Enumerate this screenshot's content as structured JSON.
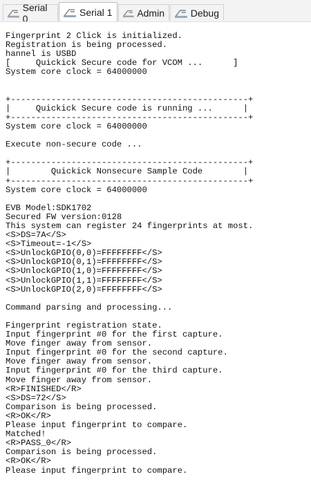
{
  "tabs": [
    {
      "label": "Serial 0",
      "icon": "serial-port-icon",
      "active": false
    },
    {
      "label": "Serial 1",
      "icon": "serial-port-icon",
      "active": true
    },
    {
      "label": "Admin",
      "icon": "serial-port-icon",
      "active": false
    },
    {
      "label": "Debug",
      "icon": "serial-port-icon",
      "active": false
    }
  ],
  "terminal": {
    "lines": [
      "Fingerprint 2 Click is initialized.",
      "Registration is being processed.",
      "hannel is USBD",
      "[     Quickick Secure code for VCOM ...      ]",
      "System core clock = 64000000",
      "",
      "",
      "+-----------------------------------------------+",
      "|     Quickick Secure code is running ...      |",
      "+-----------------------------------------------+",
      "System core clock = 64000000",
      "",
      "Execute non-secure code ...",
      "",
      "+-----------------------------------------------+",
      "|        Quickick Nonsecure Sample Code        |",
      "+-----------------------------------------------+",
      "System core clock = 64000000",
      "",
      "EVB Model:SDK1702",
      "Secured FW version:0128",
      "This system can register 24 fingerprints at most.",
      "<S>DS=7A</S>",
      "<S>Timeout=-1</S>",
      "<S>UnlockGPIO(0,0)=FFFFFFFF</S>",
      "<S>UnlockGPIO(0,1)=FFFFFFFF</S>",
      "<S>UnlockGPIO(1,0)=FFFFFFFF</S>",
      "<S>UnlockGPIO(1,1)=FFFFFFFF</S>",
      "<S>UnlockGPIO(2,0)=FFFFFFFF</S>",
      "",
      "Command parsing and processing...",
      "",
      "Fingerprint registration state.",
      "Input fingerprint #0 for the first capture.",
      "Move finger away from sensor.",
      "Input fingerprint #0 for the second capture.",
      "Move finger away from sensor.",
      "Input fingerprint #0 for the third capture.",
      "Move finger away from sensor.",
      "<R>FINISHED</R>",
      "<S>DS=72</S>",
      "Comparison is being processed.",
      "<R>OK</R>",
      "Please input fingerprint to compare.",
      "Matched!",
      "<R>PASS_0</R>",
      "Comparison is being processed.",
      "<R>OK</R>",
      "Please input fingerprint to compare."
    ]
  }
}
